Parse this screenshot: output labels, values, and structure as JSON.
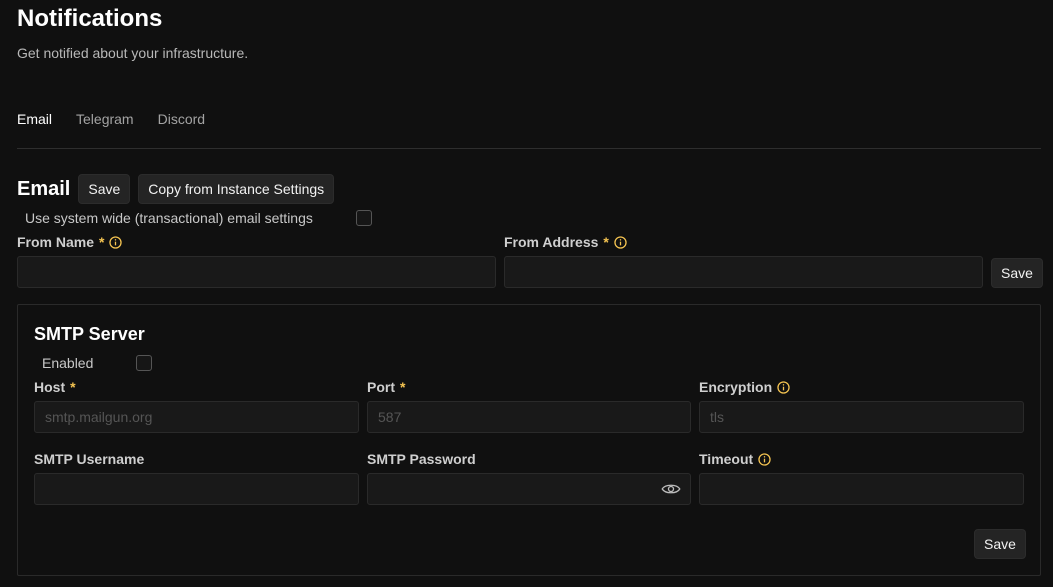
{
  "header": {
    "title": "Notifications",
    "subtitle": "Get notified about your infrastructure."
  },
  "tabs": [
    {
      "label": "Email",
      "active": true
    },
    {
      "label": "Telegram",
      "active": false
    },
    {
      "label": "Discord",
      "active": false
    }
  ],
  "email": {
    "title": "Email",
    "save_label": "Save",
    "copy_label": "Copy from Instance Settings",
    "system_wide_label": "Use system wide (transactional) email settings",
    "system_wide_checked": false,
    "from_name_label": "From Name",
    "from_name_value": "",
    "from_address_label": "From Address",
    "from_address_value": "",
    "required_mark": "*",
    "save_address_label": "Save"
  },
  "smtp": {
    "title": "SMTP Server",
    "enabled_label": "Enabled",
    "enabled_checked": false,
    "host_label": "Host",
    "host_placeholder": "smtp.mailgun.org",
    "port_label": "Port",
    "port_placeholder": "587",
    "encryption_label": "Encryption",
    "encryption_placeholder": "tls",
    "username_label": "SMTP Username",
    "password_label": "SMTP Password",
    "timeout_label": "Timeout",
    "save_label": "Save"
  },
  "colors": {
    "background": "#101010",
    "accent_required": "#f5c451",
    "info_icon": "#f5c451"
  },
  "icons": {
    "info": "info-circle-icon",
    "password_toggle": "eye-icon"
  }
}
